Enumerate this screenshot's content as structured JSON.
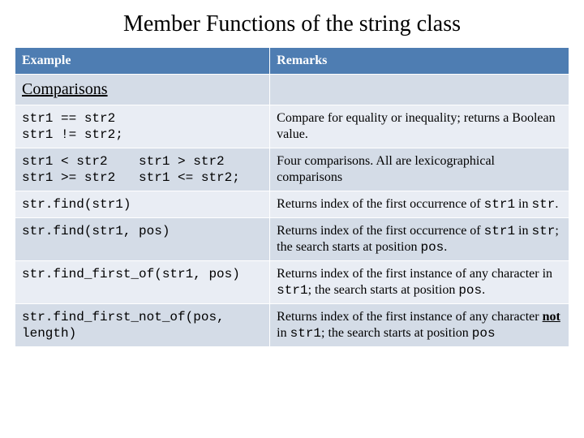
{
  "title": "Member Functions of the string class",
  "headers": {
    "example": "Example",
    "remarks": "Remarks"
  },
  "section": {
    "label": "Comparisons",
    "blank": ""
  },
  "rows": {
    "r1": {
      "code": "str1 == str2\nstr1 != str2;",
      "remark": "Compare for equality or inequality; returns a Boolean value."
    },
    "r2": {
      "code": "str1 < str2    str1 > str2\nstr1 >= str2   str1 <= str2;",
      "remark": "Four comparisons.  All are lexicographical comparisons"
    },
    "r3": {
      "code": "str.find(str1)",
      "rp1": "Returns index of the first occurrence of ",
      "rc1": "str1",
      "rp2": " in ",
      "rc2": "str",
      "rp3": "."
    },
    "r4": {
      "code": "str.find(str1, pos)",
      "rp1": "Returns index of the first occurrence of ",
      "rc1": "str1",
      "rp2": " in ",
      "rc2": "str",
      "rp3": "; the search starts at position ",
      "rc3": "pos",
      "rp4": "."
    },
    "r5": {
      "code": "str.find_first_of(str1, pos)",
      "rp1": "Returns index of the first instance of any character in ",
      "rc1": "str1",
      "rp2": "; the search starts at position ",
      "rc2": "pos",
      "rp3": "."
    },
    "r6": {
      "code": "str.find_first_not_of(pos, length)",
      "rp1": "Returns index of the first instance of any character ",
      "rnot": "not",
      "rp2": " in ",
      "rc1": "str1",
      "rp3": "; the search starts at position ",
      "rc2": "pos"
    }
  }
}
